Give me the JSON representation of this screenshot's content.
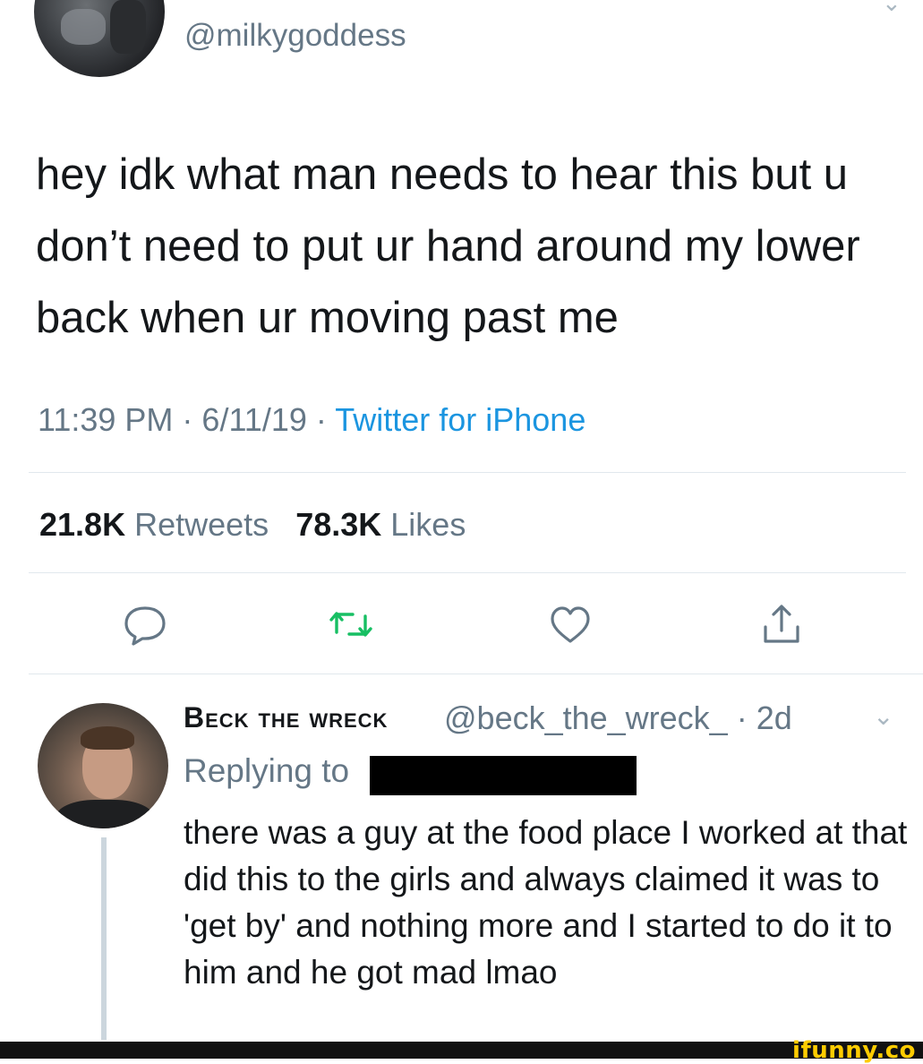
{
  "tweet": {
    "handle": "@milkygoddess",
    "text": "hey idk what man needs to hear this but u don’t need to put ur hand around my lower back when ur moving past me",
    "time": "11:39 PM",
    "date": "6/11/19",
    "separator": " · ",
    "source": "Twitter for iPhone",
    "retweets_count": "21.8K",
    "retweets_label": "Retweets",
    "likes_count": "78.3K",
    "likes_label": "Likes"
  },
  "actions": {
    "reply_icon": "reply-bubble-icon",
    "retweet_icon": "retweet-icon",
    "like_icon": "heart-icon",
    "share_icon": "share-icon",
    "retweet_color": "#17bf63",
    "icon_color": "#657786"
  },
  "reply": {
    "name": "Beck the wreck",
    "handle": "@beck_the_wreck_",
    "age": "· 2d",
    "replying_to": "Replying to",
    "text": "there was a guy at the food place I worked at that did this to the girls and always claimed it was to 'get by' and nothing more and I started to do it to him and he got mad lmao"
  },
  "watermark": "ifunny.co",
  "colors": {
    "link": "#1b95e0",
    "secondary_text": "#657786",
    "primary_text": "#14171a",
    "divider": "#e1e8ed",
    "watermark": "#ffcc00"
  }
}
